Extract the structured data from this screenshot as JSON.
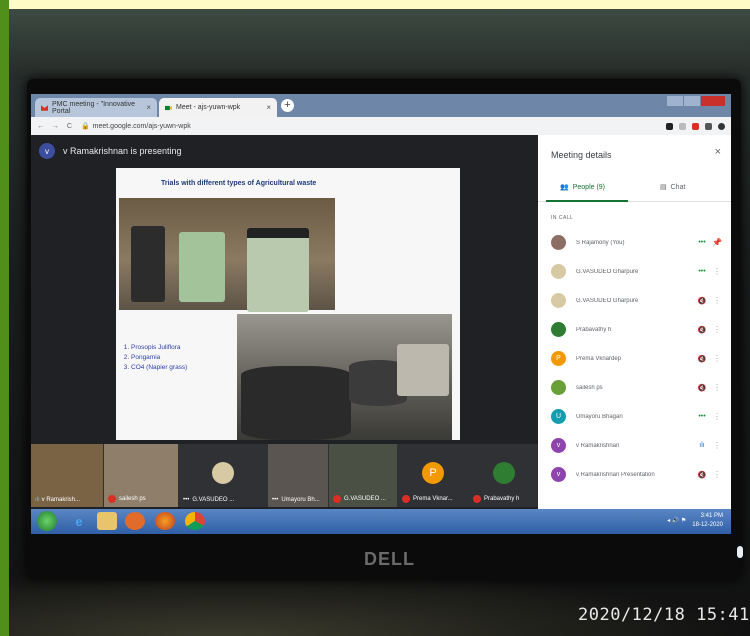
{
  "browser": {
    "tabs": [
      {
        "label": "PMC meeting - \"Innovative Portal",
        "close": "×"
      },
      {
        "label": "Meet - ajs-yuwn-wpk",
        "close": "×"
      }
    ],
    "new_tab": "+",
    "url": "meet.google.com/ajs-yuwn-wpk"
  },
  "meet": {
    "presenter_initial": "v",
    "presenting_text": "v Ramakrishnan is presenting"
  },
  "slide": {
    "title": "Trials with different  types of Agricultural waste",
    "list": [
      "Prosopis Juliflora",
      "Pongamia",
      "CO4 (Napier grass)"
    ]
  },
  "tiles": [
    {
      "name": "v Ramakrish...",
      "avatar": "",
      "color": "#7a6244"
    },
    {
      "name": "sailesh ps",
      "avatar": "",
      "color": "#8f7f6a"
    },
    {
      "name": "G.VASUDEO ...",
      "avatar": "",
      "color": "#3c4043"
    },
    {
      "name": "Umayoru Bh...",
      "avatar": "",
      "color": "#5a5550"
    },
    {
      "name": "G.VASUDEO ...",
      "avatar": "",
      "color": "#4b5044"
    },
    {
      "name": "Prema Vknar...",
      "avatar": "P",
      "color": "#3c4043"
    },
    {
      "name": "Prabavathy h",
      "avatar": "",
      "color": "#3c4043"
    }
  ],
  "panel": {
    "title": "Meeting details",
    "close": "×",
    "people_tab": "People (9)",
    "chat_tab": "Chat",
    "section": "IN CALL",
    "people": [
      {
        "initial": "",
        "name": "S Rajamony (You)",
        "color": "#8d6e63",
        "mic": "•••",
        "action": "📌"
      },
      {
        "initial": "",
        "name": "G.VASUDEO Gharpure",
        "color": "#d7c9a3",
        "mic": "•••",
        "action": "⋮"
      },
      {
        "initial": "",
        "name": "G.VASUDEO Gharpure",
        "color": "#d7c9a3",
        "mic": "🔇",
        "action": "⋮"
      },
      {
        "initial": "",
        "name": "Prabavathy h",
        "color": "#2e7d32",
        "mic": "🔇",
        "action": "⋮"
      },
      {
        "initial": "P",
        "name": "Prema Vknardep",
        "color": "#f29900",
        "mic": "🔇",
        "action": "⋮"
      },
      {
        "initial": "",
        "name": "sailesh ps",
        "color": "#689f38",
        "mic": "🔇",
        "action": "⋮"
      },
      {
        "initial": "U",
        "name": "Umayoru Bhagan",
        "color": "#129eaf",
        "mic": "•••",
        "action": "⋮"
      },
      {
        "initial": "v",
        "name": "v Ramakrishnan",
        "color": "#8e44ad",
        "mic": "ılı",
        "action": "⋮"
      },
      {
        "initial": "v",
        "name": "v Ramakrishnan Presentation",
        "color": "#8e44ad",
        "mic": "🔇",
        "action": "⋮"
      }
    ]
  },
  "taskbar": {
    "time": "3:41 PM",
    "date": "18-12-2020"
  },
  "monitor_brand": "DELL",
  "photo_timestamp": "2020/12/18  15:41",
  "colors": {
    "frame_green": "#4f8f1a",
    "frame_yellow": "#fffbc6",
    "meet_dark": "#202124",
    "people_green": "#137333"
  }
}
